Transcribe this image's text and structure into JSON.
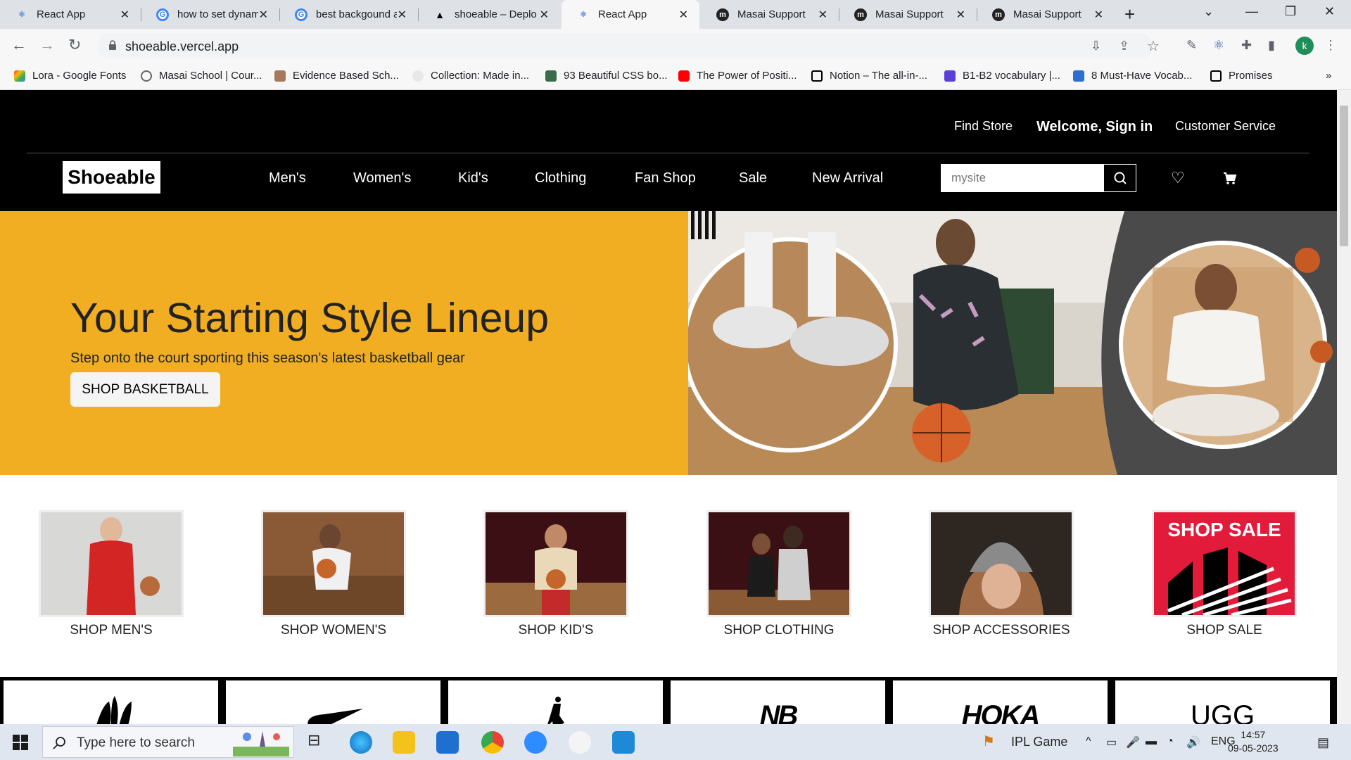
{
  "browser": {
    "tabs": [
      {
        "title": "React App",
        "favicon": "react-icon",
        "active": false
      },
      {
        "title": "how to set dynam",
        "favicon": "google-icon",
        "active": false
      },
      {
        "title": "best backgound a",
        "favicon": "google-icon",
        "active": false
      },
      {
        "title": "shoeable – Deplo",
        "favicon": "vercel-icon",
        "active": false
      },
      {
        "title": "React App",
        "favicon": "react-icon",
        "active": true
      },
      {
        "title": "Masai Support",
        "favicon": "masai-icon",
        "active": false
      },
      {
        "title": "Masai Support",
        "favicon": "masai-icon",
        "active": false
      },
      {
        "title": "Masai Support",
        "favicon": "masai-icon",
        "active": false
      }
    ],
    "url": "shoeable.vercel.app",
    "profile_initial": "k",
    "bookmarks": [
      "Lora - Google Fonts",
      "Masai School | Cour...",
      "Evidence Based Sch...",
      "Collection: Made in...",
      "93 Beautiful CSS bo...",
      "The Power of Positi...",
      "Notion – The all-in-...",
      "B1-B2 vocabulary |...",
      "8 Must-Have Vocab...",
      "Promises"
    ]
  },
  "site": {
    "top_links": {
      "find_store": "Find Store",
      "sign_in": "Welcome, Sign in",
      "customer_service": "Customer Service"
    },
    "logo": "Shoeable",
    "nav": [
      "Men's",
      "Women's",
      "Kid's",
      "Clothing",
      "Fan Shop",
      "Sale",
      "New Arrival"
    ],
    "search_value": "mysite",
    "hero": {
      "title": "Your Starting Style Lineup",
      "subtitle": "Step onto the court sporting this season's latest basketball gear",
      "cta": "SHOP BASKETBALL"
    },
    "categories": [
      "SHOP MEN'S",
      "SHOP WOMEN'S",
      "SHOP KID'S",
      "SHOP CLOTHING",
      "SHOP ACCESSORIES",
      "SHOP SALE"
    ],
    "sale_tile_text": "SHOP SALE",
    "brands": [
      "adidas-logo",
      "nike-logo",
      "jordan-logo",
      "new-balance-logo",
      "HOKA",
      "UGG"
    ],
    "brand_text": {
      "hoka": "HOKA",
      "ugg": "UGG",
      "nb": "NB"
    },
    "colors": {
      "hero_bg": "#f1ae23",
      "header_bg": "#000000",
      "sale_red": "#e31b3b"
    }
  },
  "taskbar": {
    "search_placeholder": "Type here to search",
    "weather": "IPL Game",
    "lang": "ENG",
    "time": "14:57",
    "date": "09-05-2023"
  }
}
